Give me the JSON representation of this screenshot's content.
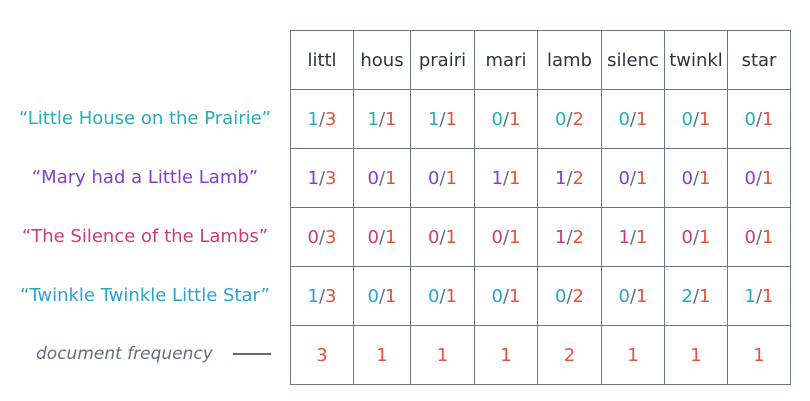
{
  "columns": [
    "littl",
    "hous",
    "prairi",
    "mari",
    "lamb",
    "silenc",
    "twinkl",
    "star"
  ],
  "documents": [
    {
      "title": "“Little House on the Prairie”",
      "color": "#22b0b8",
      "counts": [
        [
          "1",
          "3"
        ],
        [
          "1",
          "1"
        ],
        [
          "1",
          "1"
        ],
        [
          "0",
          "1"
        ],
        [
          "0",
          "2"
        ],
        [
          "0",
          "1"
        ],
        [
          "0",
          "1"
        ],
        [
          "0",
          "1"
        ]
      ]
    },
    {
      "title": "“Mary had a Little Lamb”",
      "color": "#8a3bcf",
      "counts": [
        [
          "1",
          "3"
        ],
        [
          "0",
          "1"
        ],
        [
          "0",
          "1"
        ],
        [
          "1",
          "1"
        ],
        [
          "1",
          "2"
        ],
        [
          "0",
          "1"
        ],
        [
          "0",
          "1"
        ],
        [
          "0",
          "1"
        ]
      ]
    },
    {
      "title": "“The Silence of the Lambs”",
      "color": "#cf3a78",
      "counts": [
        [
          "0",
          "3"
        ],
        [
          "0",
          "1"
        ],
        [
          "0",
          "1"
        ],
        [
          "0",
          "1"
        ],
        [
          "1",
          "2"
        ],
        [
          "1",
          "1"
        ],
        [
          "0",
          "1"
        ],
        [
          "0",
          "1"
        ]
      ]
    },
    {
      "title": "“Twinkle Twinkle Little Star”",
      "color": "#2aa3cf",
      "counts": [
        [
          "1",
          "3"
        ],
        [
          "0",
          "1"
        ],
        [
          "0",
          "1"
        ],
        [
          "0",
          "1"
        ],
        [
          "0",
          "2"
        ],
        [
          "0",
          "1"
        ],
        [
          "2",
          "1"
        ],
        [
          "1",
          "1"
        ]
      ]
    }
  ],
  "document_frequency": {
    "label": "document frequency",
    "color": "#e0563c",
    "values": [
      "3",
      "1",
      "1",
      "1",
      "2",
      "1",
      "1",
      "1"
    ]
  }
}
